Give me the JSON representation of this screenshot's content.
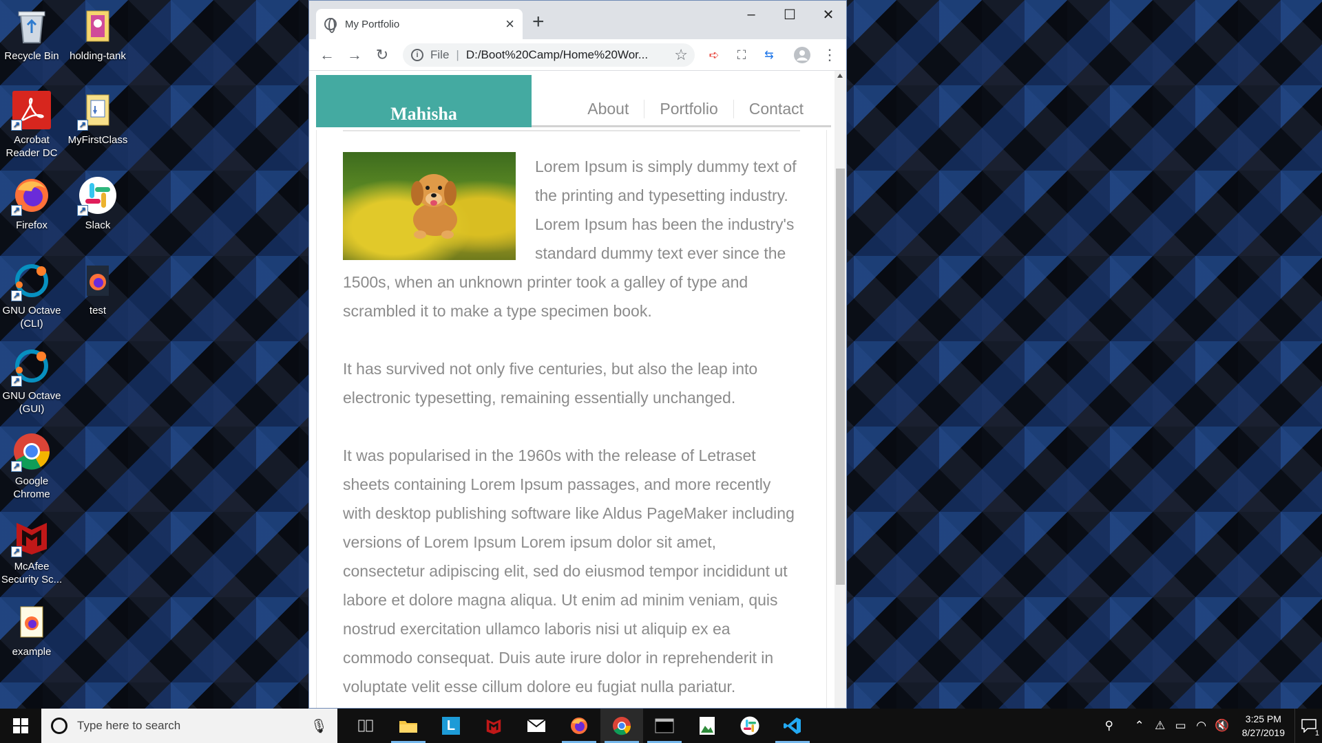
{
  "desktop": {
    "icons": [
      {
        "label": "Recycle Bin",
        "icon": "recycle-bin-icon"
      },
      {
        "label": "holding-tank",
        "icon": "folder-icon"
      },
      {
        "label": "Acrobat Reader DC",
        "icon": "acrobat-icon"
      },
      {
        "label": "MyFirstClass",
        "icon": "folder-document-icon"
      },
      {
        "label": "Firefox",
        "icon": "firefox-icon"
      },
      {
        "label": "Slack",
        "icon": "slack-icon"
      },
      {
        "label": "GNU Octave (CLI)",
        "icon": "octave-icon"
      },
      {
        "label": "test",
        "icon": "firefox-file-icon"
      },
      {
        "label": "GNU Octave (GUI)",
        "icon": "octave-icon"
      },
      {
        "label": "Google Chrome",
        "icon": "chrome-icon"
      },
      {
        "label": "McAfee Security Sc...",
        "icon": "mcafee-icon"
      },
      {
        "label": "example",
        "icon": "firefox-file-icon"
      }
    ]
  },
  "browser": {
    "tab_title": "My Portfolio",
    "address_scheme": "File",
    "address_url": "D:/Boot%20Camp/Home%20Wor...",
    "colors": {
      "accent": "#44aaa1",
      "text": "#8b8b8b"
    }
  },
  "site": {
    "brand": "Mahisha",
    "nav": [
      "About",
      "Portfolio",
      "Contact"
    ],
    "paragraphs": [
      "Lorem Ipsum is simply dummy text of the printing and typesetting industry. Lorem Ipsum has been the industry's standard dummy text ever since the 1500s, when an unknown printer took a galley of type and scrambled it to make a type specimen book.",
      "It has survived not only five centuries, but also the leap into electronic typesetting, remaining essentially unchanged.",
      "It was popularised in the 1960s with the release of Letraset sheets containing Lorem Ipsum passages, and more recently with desktop publishing software like Aldus PageMaker including versions of Lorem Ipsum Lorem ipsum dolor sit amet, consectetur adipiscing elit, sed do eiusmod tempor incididunt ut labore et dolore magna aliqua. Ut enim ad minim veniam, quis nostrud exercitation ullamco laboris nisi ut aliquip ex ea commodo consequat. Duis aute irure dolor in reprehenderit in voluptate velit esse cillum dolore eu fugiat nulla pariatur. Excepteur sint occaecat cupidatat non proident, sunt in culpa qui officia deserunt mollit anim id est laborum."
    ]
  },
  "taskbar": {
    "search_placeholder": "Type here to search",
    "time": "3:25 PM",
    "date": "8/27/2019",
    "notification_count": "1"
  }
}
